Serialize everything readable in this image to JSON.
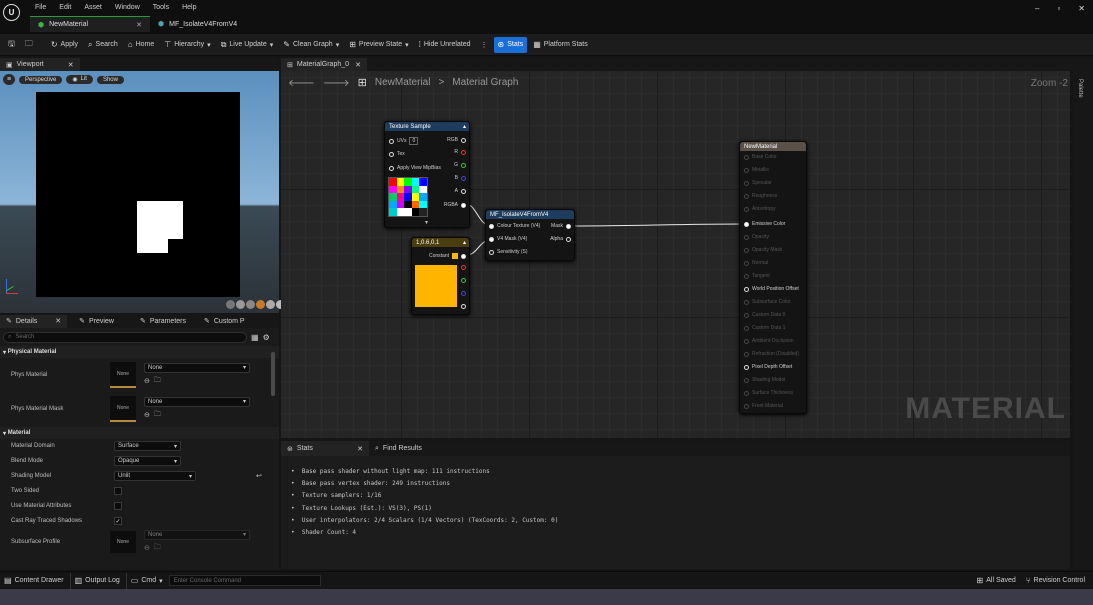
{
  "window": {
    "menu": [
      "File",
      "Edit",
      "Asset",
      "Window",
      "Tools",
      "Help"
    ],
    "tabs": [
      {
        "label": "NewMaterial"
      },
      {
        "label": "MF_IsolateV4FromV4"
      }
    ],
    "controls": {
      "minimize": "–",
      "maximize": "▫",
      "close": "✕"
    }
  },
  "toolbar": {
    "apply": "Apply",
    "search": "Search",
    "home": "Home",
    "hierarchy": "Hierarchy",
    "live_update": "Live Update",
    "clean_graph": "Clean Graph",
    "preview_state": "Preview State",
    "hide_unrelated": "Hide Unrelated",
    "stats": "Stats",
    "platform_stats": "Platform Stats"
  },
  "viewport": {
    "tab": "Viewport",
    "perspective": "Perspective",
    "lit": "Lit",
    "show": "Show"
  },
  "details": {
    "tabs": [
      "Details",
      "Preview",
      "Parameters",
      "Custom P"
    ],
    "search_placeholder": "Search",
    "sections": {
      "physical": "Physical Material",
      "material": "Material"
    },
    "phys_material": {
      "label": "Phys Material",
      "thumb": "None",
      "value": "None"
    },
    "phys_material_mask": {
      "label": "Phys Material Mask",
      "thumb": "None",
      "value": "None"
    },
    "material_domain": {
      "label": "Material Domain",
      "value": "Surface"
    },
    "blend_mode": {
      "label": "Blend Mode",
      "value": "Opaque"
    },
    "shading_model": {
      "label": "Shading Model",
      "value": "Unlit"
    },
    "two_sided": {
      "label": "Two Sided"
    },
    "use_material_attributes": {
      "label": "Use Material Attributes"
    },
    "cast_ray_traced_shadows": {
      "label": "Cast Ray Traced Shadows"
    },
    "subsurface_profile": {
      "label": "Subsurface Profile",
      "thumb": "None",
      "value": "None"
    }
  },
  "graph": {
    "tab": "MaterialGraph_0",
    "breadcrumb_root": "NewMaterial",
    "breadcrumb_sep": ">",
    "breadcrumb_leaf": "Material Graph",
    "zoom": "Zoom -2",
    "watermark": "MATERIAL",
    "palette": "Palette",
    "texture_sample": {
      "title": "Texture Sample",
      "uvs": "UVs",
      "tex": "Tex",
      "apply_mip": "Apply View MipBias",
      "rgb": "RGB",
      "r": "R",
      "g": "G",
      "b": "B",
      "a": "A",
      "rgba": "RGBA"
    },
    "constant": {
      "title": "1,0.6,0,1",
      "output": "Constant"
    },
    "isolate": {
      "title": "MF_IsolateV4FromV4",
      "in1": "Colour Texture (V4)",
      "in2": "V4 Mask (V4)",
      "in3": "Sensitivity (S)",
      "out1": "Mask",
      "out2": "Alpha"
    },
    "result": {
      "title": "NewMaterial",
      "pins": [
        "Base Color",
        "Metallic",
        "Specular",
        "Roughness",
        "Anisotropy",
        "Emissive Color",
        "Opacity",
        "Opacity Mask",
        "Normal",
        "Tangent",
        "World Position Offset",
        "Subsurface Color",
        "Custom Data 0",
        "Custom Data 1",
        "Ambient Occlusion",
        "Refraction (Disabled)",
        "Pixel Depth Offset",
        "Shading Model",
        "Surface Thickness",
        "Front Material"
      ]
    }
  },
  "stats": {
    "tabs": [
      "Stats",
      "Find Results"
    ],
    "lines": [
      "Base pass shader without light map: 111 instructions",
      "Base pass vertex shader: 249 instructions",
      "Texture samplers: 1/16",
      "Texture Lookups (Est.): VS(3), PS(1)",
      "User interpolators: 2/4 Scalars (1/4 Vectors) (TexCoords: 2, Custom: 0)",
      "Shader Count: 4"
    ]
  },
  "bottom": {
    "content_drawer": "Content Drawer",
    "output_log": "Output Log",
    "cmd": "Cmd",
    "console_placeholder": "Enter Console Command",
    "all_saved": "All Saved",
    "revision_control": "Revision Control"
  },
  "colors": {
    "accent": "#1a6fd8",
    "constant": "#ffb500",
    "node_header": "#1e3d5e"
  }
}
